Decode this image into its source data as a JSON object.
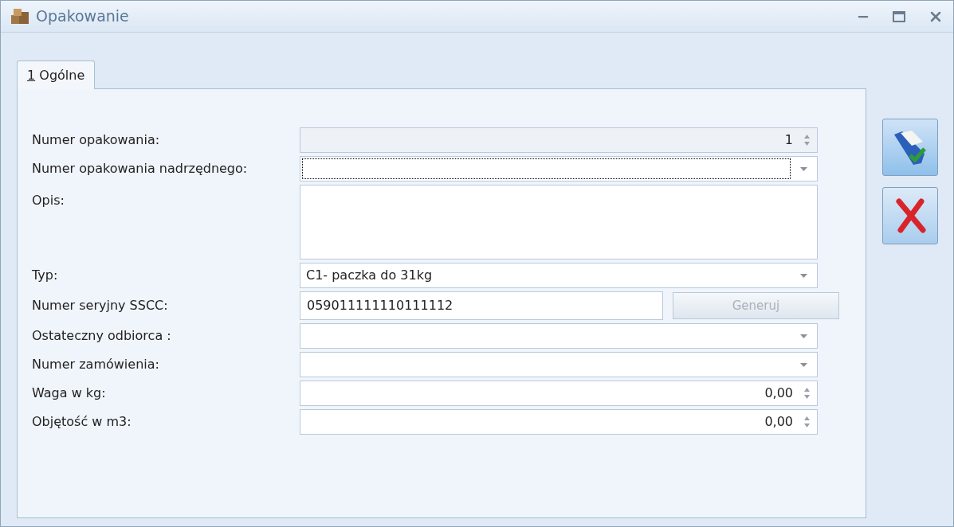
{
  "window": {
    "title": "Opakowanie"
  },
  "tabs": [
    {
      "hotkey": "1",
      "label": "Ogólne",
      "selected": true
    }
  ],
  "fields": [
    {
      "kind": "spin",
      "label": "Numer opakowania:",
      "value": "1",
      "disabled": true,
      "focused": false
    },
    {
      "kind": "combo",
      "label": "Numer opakowania nadrzędnego:",
      "disabled": false,
      "focused": true
    },
    {
      "kind": "memo",
      "label": "Opis:",
      "disabled": false,
      "focused": false
    },
    {
      "kind": "combo",
      "label": "Typ:",
      "value": "C1- paczka do 31kg",
      "disabled": false,
      "focused": false
    },
    {
      "kind": "text_button",
      "label": "Numer seryjny SSCC:",
      "value": "059011111110111112",
      "disabled": false,
      "focused": false,
      "button": {
        "label": "Generuj",
        "disabled": true
      }
    },
    {
      "kind": "combo",
      "label": "Ostateczny odbiorca :",
      "disabled": false,
      "focused": false
    },
    {
      "kind": "combo",
      "label": "Numer zamówienia:",
      "disabled": false,
      "focused": false
    },
    {
      "kind": "spin",
      "label": "Waga w kg:",
      "value": "0,00",
      "disabled": false,
      "focused": false
    },
    {
      "kind": "spin",
      "label": "Objętość w m3:",
      "value": "0,00",
      "disabled": false,
      "focused": false
    }
  ]
}
